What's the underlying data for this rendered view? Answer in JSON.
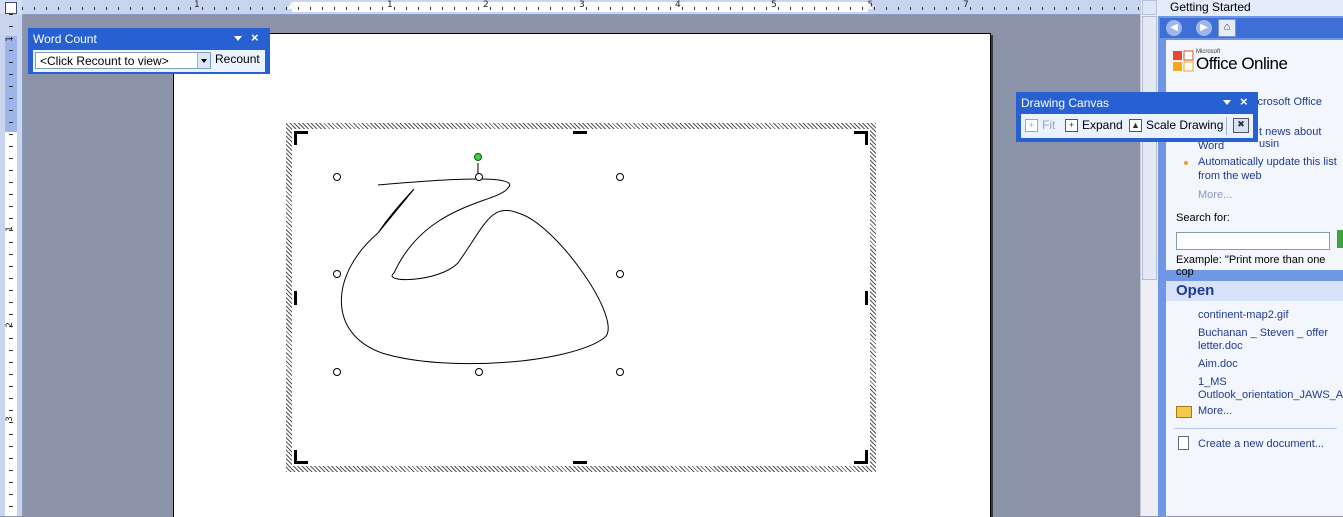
{
  "ruler": {
    "h_numbers": [
      "1",
      "1",
      "2",
      "3",
      "4",
      "5",
      "6",
      "7"
    ],
    "v_numbers": [
      "1",
      "1",
      "2",
      "3"
    ]
  },
  "word_count": {
    "title": "Word Count",
    "combo_value": "<Click Recount to view>",
    "recount_label": "Recount"
  },
  "drawing_canvas": {
    "title": "Drawing Canvas",
    "fit_label": "Fit",
    "expand_label": "Expand",
    "scale_label": "Scale Drawing"
  },
  "taskpane": {
    "title": "Getting Started",
    "logo_small": "Microsoft",
    "logo_big": "Office Online",
    "links": [
      {
        "text": "icrosoft Office"
      },
      {
        "text": "t news about usin"
      },
      {
        "text": "Word"
      },
      {
        "text": "Automatically update this list"
      },
      {
        "text": "from the web"
      },
      {
        "text": "More..."
      }
    ],
    "search_label": "Search for:",
    "search_value": "",
    "example": "Example:  \"Print more than one cop",
    "open_header": "Open",
    "recent": [
      "continent-map2.gif",
      "Buchanan _ Steven _ offer",
      "letter.doc",
      "Aim.doc",
      "1_MS",
      "Outlook_orientation_JAWS_Ar"
    ],
    "more_label": "More...",
    "new_doc_label": "Create a new document..."
  }
}
